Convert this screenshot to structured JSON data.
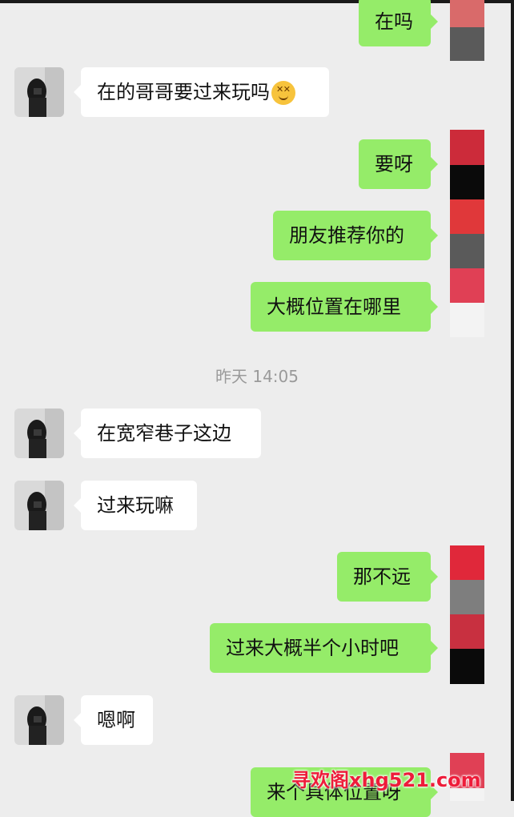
{
  "chat": {
    "timestamp": "昨天 14:05",
    "messages": [
      {
        "side": "out",
        "text": "在吗"
      },
      {
        "side": "in",
        "text": "在的哥哥要过来玩吗",
        "emoji": "dizzy-face-emoji"
      },
      {
        "side": "out",
        "text": "要呀"
      },
      {
        "side": "out",
        "text": "朋友推荐你的"
      },
      {
        "side": "out",
        "text": "大概位置在哪里"
      },
      {
        "side": "in",
        "text": "在宽窄巷子这边"
      },
      {
        "side": "in",
        "text": "过来玩嘛"
      },
      {
        "side": "out",
        "text": "那不远"
      },
      {
        "side": "out",
        "text": "过来大概半个小时吧"
      },
      {
        "side": "in",
        "text": "嗯啊"
      },
      {
        "side": "out",
        "text": "来个具体位置呀"
      }
    ]
  },
  "colors": {
    "background": "#ededed",
    "incoming_bubble": "#ffffff",
    "outgoing_bubble": "#95ec69",
    "timestamp_text": "#9a9a9a",
    "watermark": "#ee1c3a",
    "swatches_1": [
      "#d96a6a",
      "#5a5a5a"
    ],
    "swatches_2": [
      "#cc2b3a",
      "#0a0a0a",
      "#e0383a",
      "#5a5a5a",
      "#e04055",
      "#f3f3f3"
    ],
    "swatches_3": [
      "#e0283a",
      "#7e7e7e",
      "#c83040",
      "#0a0a0a"
    ],
    "swatches_4": [
      "#e04055",
      "#f3f3f3"
    ]
  },
  "watermark": {
    "text": "寻欢阁xhg521.com"
  }
}
